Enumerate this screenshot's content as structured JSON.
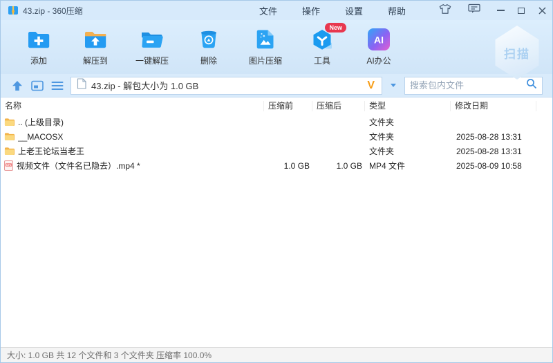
{
  "window": {
    "title": "43.zip - 360压缩",
    "menus": [
      {
        "key": "file",
        "label": "文件"
      },
      {
        "key": "operations",
        "label": "操作"
      },
      {
        "key": "settings",
        "label": "设置"
      },
      {
        "key": "help",
        "label": "帮助"
      }
    ]
  },
  "toolbar": {
    "buttons": [
      {
        "key": "add",
        "label": "添加",
        "icon": "folder-add"
      },
      {
        "key": "extract-to",
        "label": "解压到",
        "icon": "folder-extract"
      },
      {
        "key": "one-click-extract",
        "label": "一键解压",
        "icon": "folder-oneclick"
      },
      {
        "key": "delete",
        "label": "删除",
        "icon": "trash"
      },
      {
        "key": "image-compress",
        "label": "图片压缩",
        "icon": "image-compress"
      },
      {
        "key": "tools",
        "label": "工具",
        "icon": "tools-hexagon",
        "badge": "New"
      },
      {
        "key": "ai-office",
        "label": "AI办公",
        "icon": "ai"
      }
    ],
    "scan_label": "扫描"
  },
  "addressbar": {
    "path": "43.zip - 解包大小为 1.0 GB",
    "v_badge": "V",
    "search_placeholder": "搜索包内文件"
  },
  "table": {
    "headers": [
      "名称",
      "压缩前",
      "压缩后",
      "类型",
      "修改日期"
    ],
    "rows": [
      {
        "icon": "folder",
        "name": ".. (上级目录)",
        "before": "",
        "after": "",
        "type": "文件夹",
        "date": ""
      },
      {
        "icon": "folder",
        "name": "__MACOSX",
        "before": "",
        "after": "",
        "type": "文件夹",
        "date": "2025-08-28 13:31"
      },
      {
        "icon": "folder",
        "name": "上老王论坛当老王",
        "before": "",
        "after": "",
        "type": "文件夹",
        "date": "2025-08-28 13:31"
      },
      {
        "icon": "mp4",
        "name": "视频文件（文件名已隐去）.mp4 *",
        "before": "1.0 GB",
        "after": "1.0 GB",
        "type": "MP4 文件",
        "date": "2025-08-09 10:58"
      }
    ]
  },
  "statusbar": {
    "text": "大小: 1.0 GB 共 12 个文件和 3 个文件夹 压缩率 100.0%"
  }
}
